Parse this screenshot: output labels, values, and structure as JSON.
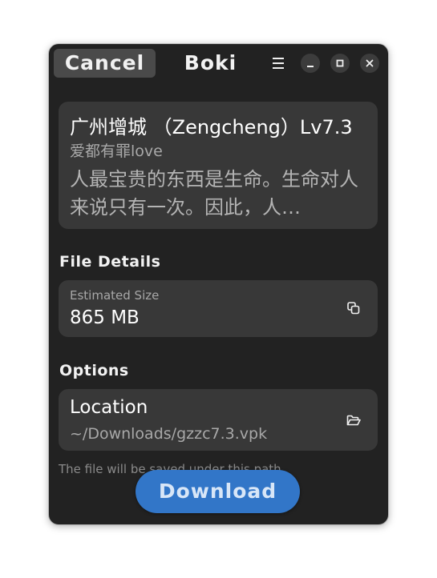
{
  "header": {
    "cancel_label": "Cancel",
    "title": "Boki",
    "menu_icon": "hamburger-menu-icon",
    "minimize_icon": "minimize-icon",
    "maximize_icon": "maximize-icon",
    "close_icon": "close-icon"
  },
  "info": {
    "title": "广州增城 （Zengcheng）Lv7.3",
    "author": "爱都有罪love",
    "description": " 人最宝贵的东西是生命。生命对人来说只有一次。因此，人…"
  },
  "file_details": {
    "heading": "File Details",
    "size_label": "Estimated Size",
    "size_value": "865 MB",
    "copy_icon": "copy-icon"
  },
  "options": {
    "heading": "Options",
    "location_label": "Location",
    "location_path": "~/Downloads/gzzc7.3.vpk",
    "folder_icon": "folder-open-icon",
    "hint": "The file will be saved under this path."
  },
  "actions": {
    "download_label": "Download"
  },
  "colors": {
    "window_bg": "#222222",
    "card_bg": "#383838",
    "accent": "#3276c8"
  }
}
